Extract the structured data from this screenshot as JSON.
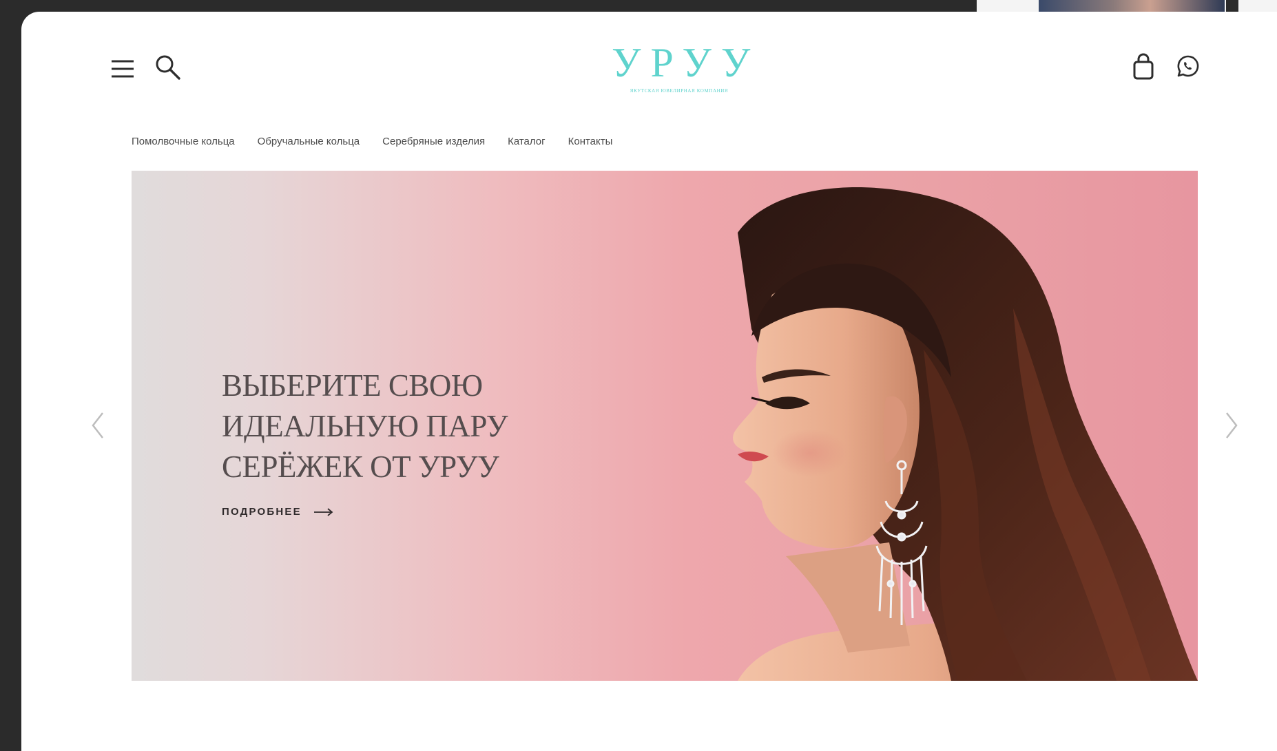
{
  "brand": {
    "name": "УРУУ",
    "tagline": "ЯКУТСКАЯ ЮВЕЛИРНАЯ КОМПАНИЯ",
    "accent_color": "#5fd3cd"
  },
  "header": {
    "menu_icon": "hamburger-menu-icon",
    "search_icon": "search-icon",
    "cart_icon": "shopping-bag-icon",
    "whatsapp_icon": "whatsapp-icon"
  },
  "nav": {
    "items": [
      {
        "label": "Помолвочные кольца"
      },
      {
        "label": "Обручальные кольца"
      },
      {
        "label": "Серебряные изделия"
      },
      {
        "label": "Каталог"
      },
      {
        "label": "Контакты"
      }
    ]
  },
  "hero": {
    "title": "ВЫБЕРИТЕ СВОЮ\nИДЕАЛЬНУЮ ПАРУ\nСЕРЁЖЕК ОТ УРУУ",
    "cta_label": "ПОДРОБНЕЕ",
    "cta_icon": "arrow-right-icon",
    "image": "woman-with-silver-earring-photo",
    "prev_icon": "chevron-left-icon",
    "next_icon": "chevron-right-icon"
  }
}
